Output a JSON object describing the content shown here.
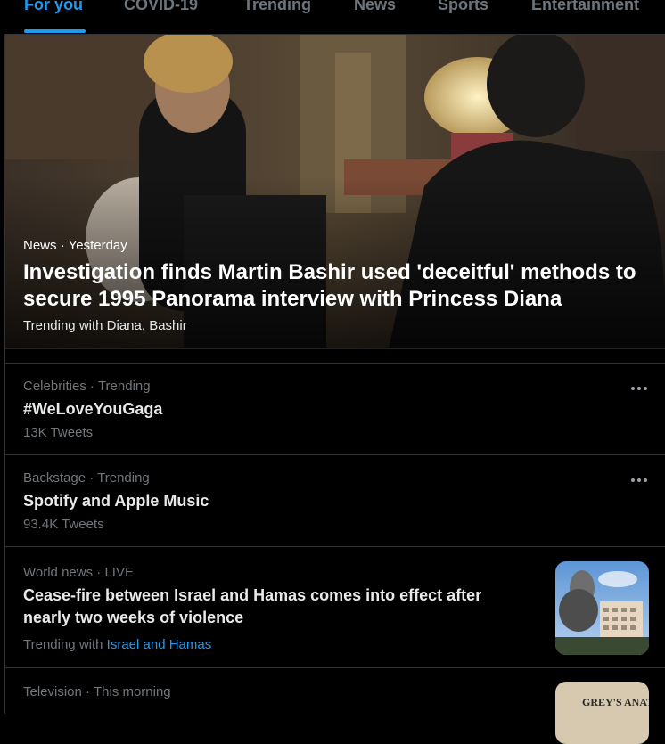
{
  "tabs": [
    "For you",
    "COVID-19",
    "Trending",
    "News",
    "Sports",
    "Entertainment"
  ],
  "hero": {
    "category": "News",
    "time": "Yesterday",
    "title": "Investigation finds Martin Bashir used 'deceitful' methods to secure 1995 Panorama interview with Princess Diana",
    "trending_prefix": "Trending with",
    "trending_terms": "Diana, Bashir"
  },
  "trends": [
    {
      "context": "Celebrities",
      "status": "Trending",
      "title": "#WeLoveYouGaga",
      "count": "13K Tweets"
    },
    {
      "context": "Backstage",
      "status": "Trending",
      "title": "Spotify and Apple Music",
      "count": "93.4K Tweets"
    },
    {
      "context": "World news",
      "status": "LIVE",
      "title": "Cease-fire between Israel and Hamas comes into effect after nearly two weeks of violence",
      "trending_prefix": "Trending with",
      "trending_link": "Israel and Hamas"
    },
    {
      "context": "Television",
      "status": "This morning",
      "thumb_text": "GREY'S ANATOM"
    }
  ],
  "separator": "·",
  "colors": {
    "accent": "#1d9bf0",
    "background": "#000000",
    "muted": "#71767b"
  }
}
